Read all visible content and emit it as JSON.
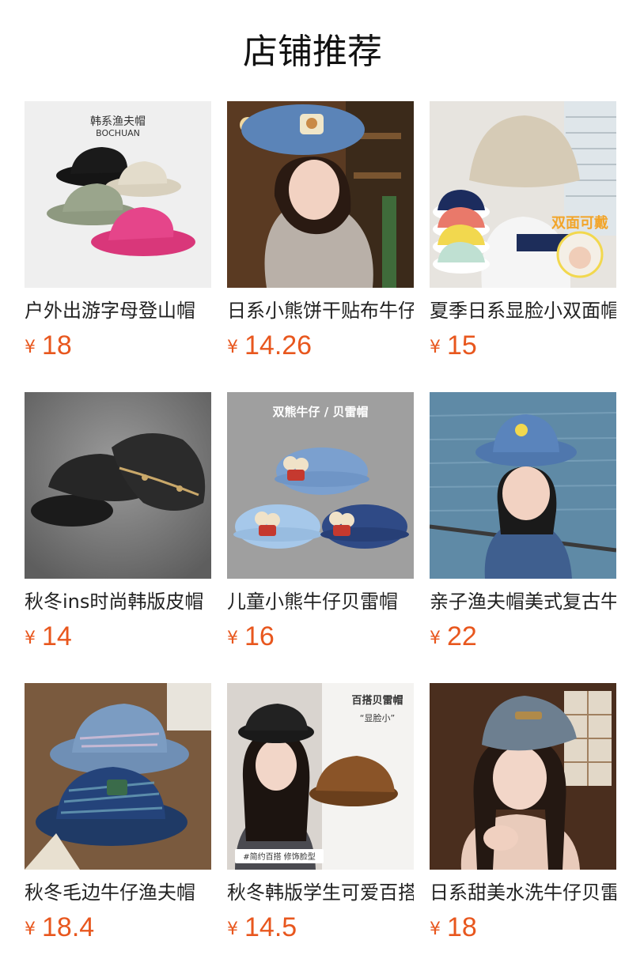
{
  "header": {
    "title": "店铺推荐"
  },
  "currency_symbol": "¥",
  "accent_color": "#e8571e",
  "products": [
    {
      "title": "户外出游字母登山帽",
      "price": "18",
      "image_text": [
        "韩系渔夫帽",
        "BOCHUAN"
      ]
    },
    {
      "title": "日系小熊饼干贴布牛仔",
      "price": "14.26"
    },
    {
      "title": "夏季日系显脸小双面帽",
      "price": "15",
      "image_text": [
        "双面可戴"
      ]
    },
    {
      "title": "秋冬ins时尚韩版皮帽",
      "price": "14"
    },
    {
      "title": "儿童小熊牛仔贝雷帽",
      "price": "16",
      "image_text": [
        "双熊牛仔 / 贝雷帽"
      ]
    },
    {
      "title": "亲子渔夫帽美式复古牛",
      "price": "22"
    },
    {
      "title": "秋冬毛边牛仔渔夫帽",
      "price": "18.4"
    },
    {
      "title": "秋冬韩版学生可爱百搭",
      "price": "14.5",
      "image_text": [
        "百搭贝雷帽",
        "“显脸小”",
        "#简约百搭 修饰脸型"
      ]
    },
    {
      "title": "日系甜美水洗牛仔贝雷",
      "price": "18"
    }
  ]
}
